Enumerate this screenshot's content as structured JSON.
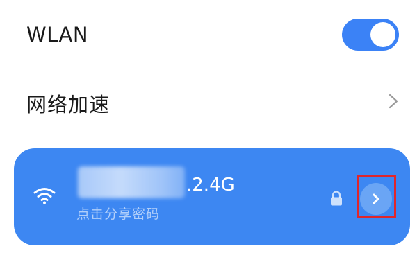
{
  "wlan": {
    "label": "WLAN",
    "toggle_on": true
  },
  "network_accel": {
    "label": "网络加速",
    "chevron_icon": "chevron-right-icon"
  },
  "connected_network": {
    "ssid_suffix": ".2.4G",
    "subtitle": "点击分享密码",
    "wifi_icon": "wifi-icon",
    "lock_icon": "lock-icon",
    "detail_icon": "chevron-right-icon"
  },
  "colors": {
    "accent": "#3b82f6",
    "card": "#3d87f2",
    "highlight": "#e0262b"
  }
}
